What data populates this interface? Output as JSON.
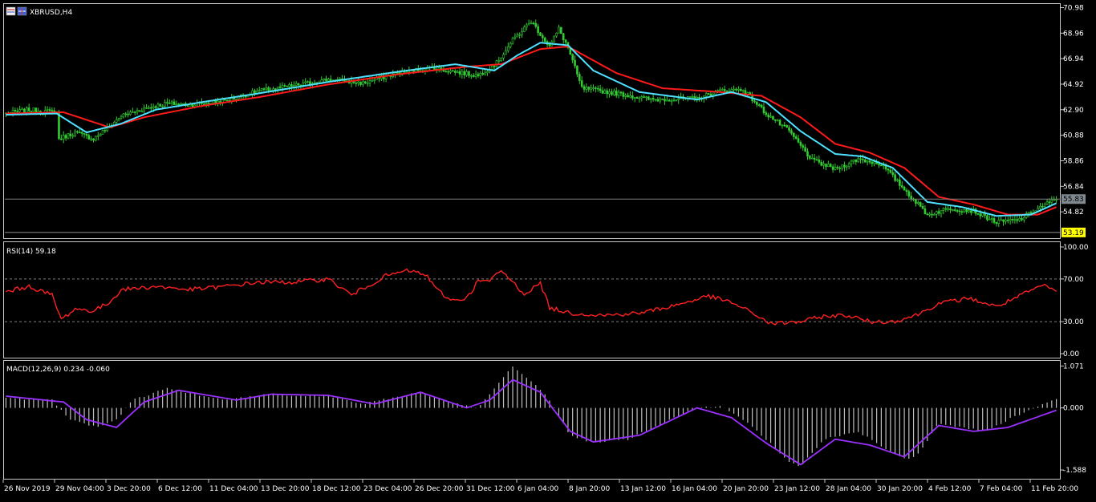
{
  "window": {
    "symbol_label": "XBRUSD,H4",
    "icon_name": "chart-window-icon"
  },
  "colors": {
    "background": "#000000",
    "frame": "#c8c8c8",
    "grid": "#808080",
    "candle": "#32cd32",
    "ma_fast": "#4de1ff",
    "ma_slow": "#ff1a1a",
    "rsi": "#ff2020",
    "macd_hist": "#c0c0c0",
    "macd_signal": "#9b30ff",
    "price_tag_bg": "#808890",
    "low_tag_bg": "#ffff00"
  },
  "chart_data": [
    {
      "type": "candlestick",
      "name": "price",
      "y_ticks": [
        "70.98",
        "68.96",
        "66.94",
        "64.92",
        "62.90",
        "60.88",
        "58.86",
        "56.84",
        "54.82"
      ],
      "ylim": [
        52.8,
        71.2
      ],
      "current_price_label": "55.83",
      "current_price": 55.83,
      "low_label": "53.19",
      "low_price": 53.19,
      "anchors_close": [
        [
          0,
          62.6
        ],
        [
          10,
          62.9
        ],
        [
          22,
          62.7
        ],
        [
          23,
          60.6
        ],
        [
          30,
          61.1
        ],
        [
          38,
          60.6
        ],
        [
          45,
          61.6
        ],
        [
          50,
          62.4
        ],
        [
          60,
          63.0
        ],
        [
          70,
          63.4
        ],
        [
          80,
          63.3
        ],
        [
          95,
          63.6
        ],
        [
          110,
          64.4
        ],
        [
          125,
          64.8
        ],
        [
          140,
          65.3
        ],
        [
          155,
          65.0
        ],
        [
          170,
          65.8
        ],
        [
          185,
          66.2
        ],
        [
          195,
          65.9
        ],
        [
          205,
          65.6
        ],
        [
          213,
          66.6
        ],
        [
          220,
          68.4
        ],
        [
          228,
          69.9
        ],
        [
          232,
          68.9
        ],
        [
          236,
          67.9
        ],
        [
          240,
          69.3
        ],
        [
          244,
          67.8
        ],
        [
          250,
          64.6
        ],
        [
          265,
          64.2
        ],
        [
          280,
          63.7
        ],
        [
          300,
          63.8
        ],
        [
          310,
          64.4
        ],
        [
          320,
          64.5
        ],
        [
          330,
          62.6
        ],
        [
          340,
          61.2
        ],
        [
          350,
          58.9
        ],
        [
          360,
          58.2
        ],
        [
          370,
          59.0
        ],
        [
          380,
          58.6
        ],
        [
          390,
          56.6
        ],
        [
          400,
          54.6
        ],
        [
          410,
          55.1
        ],
        [
          420,
          54.9
        ],
        [
          430,
          54.0
        ],
        [
          440,
          54.2
        ],
        [
          450,
          55.3
        ],
        [
          456,
          55.8
        ]
      ],
      "ma_fast_anchors": [
        [
          0,
          62.5
        ],
        [
          22,
          62.6
        ],
        [
          35,
          61.1
        ],
        [
          50,
          61.8
        ],
        [
          65,
          62.9
        ],
        [
          85,
          63.5
        ],
        [
          110,
          64.2
        ],
        [
          140,
          65.1
        ],
        [
          170,
          65.9
        ],
        [
          195,
          66.5
        ],
        [
          212,
          66.0
        ],
        [
          222,
          67.2
        ],
        [
          232,
          68.2
        ],
        [
          244,
          68.0
        ],
        [
          255,
          66.0
        ],
        [
          275,
          64.3
        ],
        [
          300,
          63.7
        ],
        [
          315,
          64.3
        ],
        [
          330,
          63.5
        ],
        [
          345,
          61.2
        ],
        [
          360,
          59.4
        ],
        [
          372,
          59.2
        ],
        [
          385,
          58.3
        ],
        [
          400,
          55.6
        ],
        [
          415,
          55.2
        ],
        [
          430,
          54.5
        ],
        [
          445,
          54.6
        ],
        [
          456,
          55.5
        ]
      ],
      "ma_slow_anchors": [
        [
          0,
          62.6
        ],
        [
          25,
          62.7
        ],
        [
          45,
          61.5
        ],
        [
          60,
          62.3
        ],
        [
          85,
          63.2
        ],
        [
          110,
          63.9
        ],
        [
          140,
          64.9
        ],
        [
          170,
          65.7
        ],
        [
          200,
          66.3
        ],
        [
          215,
          66.5
        ],
        [
          232,
          67.7
        ],
        [
          244,
          67.9
        ],
        [
          265,
          65.8
        ],
        [
          285,
          64.6
        ],
        [
          310,
          64.3
        ],
        [
          328,
          64.0
        ],
        [
          345,
          62.3
        ],
        [
          360,
          60.2
        ],
        [
          375,
          59.5
        ],
        [
          390,
          58.3
        ],
        [
          405,
          56.0
        ],
        [
          420,
          55.4
        ],
        [
          435,
          54.6
        ],
        [
          448,
          54.6
        ],
        [
          456,
          55.2
        ]
      ]
    },
    {
      "type": "line",
      "name": "rsi",
      "label": "RSI(14) 59.18",
      "y_ticks": [
        "100.00",
        "70.00",
        "30.00",
        "0.00"
      ],
      "ylim": [
        0,
        100
      ],
      "levels": [
        70,
        30
      ],
      "anchors": [
        [
          0,
          58
        ],
        [
          10,
          63
        ],
        [
          20,
          55
        ],
        [
          24,
          32
        ],
        [
          30,
          42
        ],
        [
          38,
          40
        ],
        [
          45,
          48
        ],
        [
          50,
          60
        ],
        [
          65,
          63
        ],
        [
          80,
          60
        ],
        [
          95,
          63
        ],
        [
          110,
          67
        ],
        [
          125,
          67
        ],
        [
          140,
          70
        ],
        [
          150,
          55
        ],
        [
          165,
          73
        ],
        [
          175,
          78
        ],
        [
          183,
          73
        ],
        [
          186,
          62
        ],
        [
          193,
          50
        ],
        [
          200,
          52
        ],
        [
          205,
          68
        ],
        [
          210,
          68
        ],
        [
          215,
          78
        ],
        [
          225,
          56
        ],
        [
          232,
          66
        ],
        [
          236,
          43
        ],
        [
          245,
          38
        ],
        [
          260,
          36
        ],
        [
          275,
          38
        ],
        [
          290,
          45
        ],
        [
          305,
          54
        ],
        [
          315,
          48
        ],
        [
          325,
          37
        ],
        [
          332,
          28
        ],
        [
          345,
          30
        ],
        [
          355,
          35
        ],
        [
          365,
          36
        ],
        [
          375,
          30
        ],
        [
          385,
          30
        ],
        [
          395,
          36
        ],
        [
          405,
          47
        ],
        [
          418,
          52
        ],
        [
          430,
          44
        ],
        [
          440,
          54
        ],
        [
          450,
          64
        ],
        [
          456,
          59
        ]
      ]
    },
    {
      "type": "bar+line",
      "name": "macd",
      "label": "MACD(12,26,9) 0.234 -0.060",
      "y_ticks": [
        "1.071",
        "0.000",
        "-1.588"
      ],
      "ylim": [
        -1.75,
        1.1
      ],
      "histogram_anchors": [
        [
          0,
          0.25
        ],
        [
          20,
          0.2
        ],
        [
          28,
          -0.3
        ],
        [
          40,
          -0.5
        ],
        [
          48,
          -0.3
        ],
        [
          55,
          0.2
        ],
        [
          70,
          0.5
        ],
        [
          85,
          0.3
        ],
        [
          95,
          0.2
        ],
        [
          115,
          0.35
        ],
        [
          140,
          0.3
        ],
        [
          155,
          0.1
        ],
        [
          180,
          0.4
        ],
        [
          195,
          0.1
        ],
        [
          205,
          0.0
        ],
        [
          215,
          0.7
        ],
        [
          220,
          1.05
        ],
        [
          230,
          0.6
        ],
        [
          236,
          0.2
        ],
        [
          245,
          -0.7
        ],
        [
          255,
          -0.9
        ],
        [
          270,
          -0.8
        ],
        [
          285,
          -0.4
        ],
        [
          300,
          0.0
        ],
        [
          310,
          0.05
        ],
        [
          320,
          -0.3
        ],
        [
          330,
          -0.8
        ],
        [
          340,
          -1.4
        ],
        [
          345,
          -1.5
        ],
        [
          355,
          -0.8
        ],
        [
          370,
          -0.6
        ],
        [
          380,
          -1.0
        ],
        [
          390,
          -1.3
        ],
        [
          395,
          -1.25
        ],
        [
          405,
          -0.4
        ],
        [
          415,
          -0.5
        ],
        [
          425,
          -0.6
        ],
        [
          435,
          -0.3
        ],
        [
          450,
          0.1
        ],
        [
          456,
          0.25
        ]
      ],
      "signal_anchors": [
        [
          0,
          0.3
        ],
        [
          25,
          0.15
        ],
        [
          35,
          -0.3
        ],
        [
          48,
          -0.5
        ],
        [
          60,
          0.15
        ],
        [
          75,
          0.45
        ],
        [
          90,
          0.3
        ],
        [
          100,
          0.2
        ],
        [
          115,
          0.35
        ],
        [
          140,
          0.32
        ],
        [
          160,
          0.1
        ],
        [
          180,
          0.4
        ],
        [
          200,
          0.0
        ],
        [
          210,
          0.2
        ],
        [
          220,
          0.72
        ],
        [
          232,
          0.4
        ],
        [
          245,
          -0.6
        ],
        [
          255,
          -0.87
        ],
        [
          275,
          -0.7
        ],
        [
          300,
          0.0
        ],
        [
          315,
          -0.25
        ],
        [
          330,
          -0.9
        ],
        [
          345,
          -1.45
        ],
        [
          360,
          -0.8
        ],
        [
          375,
          -0.95
        ],
        [
          390,
          -1.25
        ],
        [
          405,
          -0.45
        ],
        [
          420,
          -0.6
        ],
        [
          435,
          -0.5
        ],
        [
          456,
          -0.06
        ]
      ]
    }
  ],
  "time_axis": {
    "labels": [
      "26 Nov 2019",
      "29 Nov 04:00",
      "3 Dec 20:00",
      "6 Dec 12:00",
      "11 Dec 04:00",
      "13 Dec 20:00",
      "18 Dec 12:00",
      "23 Dec 04:00",
      "26 Dec 20:00",
      "31 Dec 12:00",
      "6 Jan 04:00",
      "8 Jan 20:00",
      "13 Jan 12:00",
      "16 Jan 04:00",
      "20 Jan 20:00",
      "23 Jan 12:00",
      "28 Jan 04:00",
      "30 Jan 20:00",
      "4 Feb 12:00",
      "7 Feb 04:00",
      "11 Feb 20:00"
    ]
  }
}
